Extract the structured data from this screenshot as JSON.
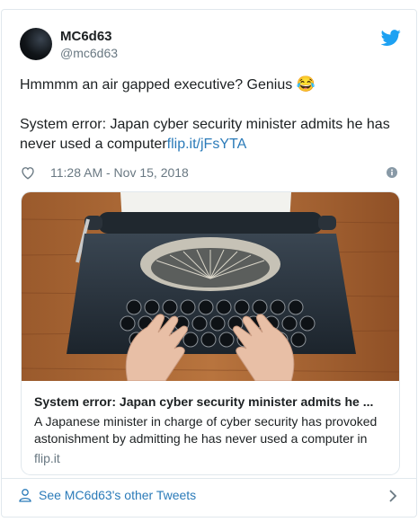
{
  "user": {
    "display_name": "MC6d63",
    "screen_name": "@mc6d63"
  },
  "tweet": {
    "line1": "Hmmmm an air gapped executive? Genius ",
    "emoji": "😂",
    "line2": "System error: Japan cyber security minister admits he has never used a computer",
    "link": "flip.it/jFsYTA",
    "timestamp": "11:28 AM - Nov 15, 2018"
  },
  "card": {
    "title": "System error: Japan cyber security minister admits he ...",
    "description": "A Japanese minister in charge of cyber security has provoked astonishment by admitting he has never used a computer in",
    "domain": "flip.it"
  },
  "footer": {
    "label": "See MC6d63's other Tweets"
  },
  "colors": {
    "twitter_blue": "#1da1f2",
    "link": "#2b7bb9",
    "muted": "#697882",
    "border": "#e1e8ed"
  },
  "icons": [
    "twitter-logo-icon",
    "heart-icon",
    "info-icon",
    "person-icon",
    "chevron-right-icon"
  ]
}
